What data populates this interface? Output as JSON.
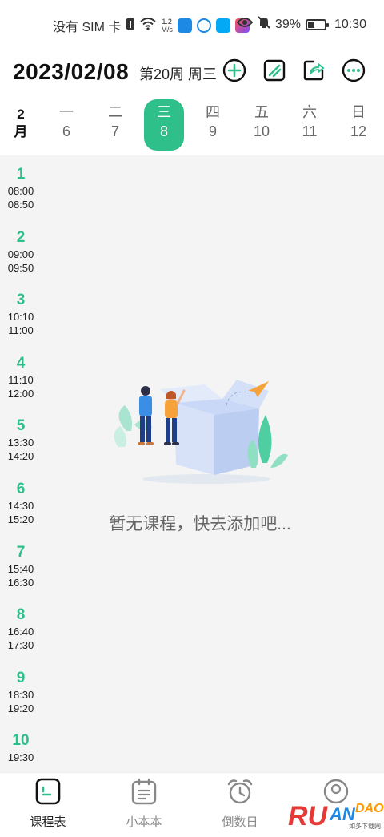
{
  "status_bar": {
    "carrier": "没有 SIM 卡",
    "net_speed_value": "1.2",
    "net_speed_unit": "M/s",
    "battery": "39%",
    "battery_level": 0.39,
    "time": "10:30"
  },
  "header": {
    "date": "2023/02/08",
    "week_info": "第20周 周三"
  },
  "week": {
    "month_num": "2",
    "month_unit": "月",
    "days": [
      {
        "weekday": "一",
        "date": "6"
      },
      {
        "weekday": "二",
        "date": "7"
      },
      {
        "weekday": "三",
        "date": "8"
      },
      {
        "weekday": "四",
        "date": "9"
      },
      {
        "weekday": "五",
        "date": "10"
      },
      {
        "weekday": "六",
        "date": "11"
      },
      {
        "weekday": "日",
        "date": "12"
      }
    ],
    "selected_index": 2
  },
  "periods": [
    {
      "num": "1",
      "start": "08:00",
      "end": "08:50"
    },
    {
      "num": "2",
      "start": "09:00",
      "end": "09:50"
    },
    {
      "num": "3",
      "start": "10:10",
      "end": "11:00"
    },
    {
      "num": "4",
      "start": "11:10",
      "end": "12:00"
    },
    {
      "num": "5",
      "start": "13:30",
      "end": "14:20"
    },
    {
      "num": "6",
      "start": "14:30",
      "end": "15:20"
    },
    {
      "num": "7",
      "start": "15:40",
      "end": "16:30"
    },
    {
      "num": "8",
      "start": "16:40",
      "end": "17:30"
    },
    {
      "num": "9",
      "start": "18:30",
      "end": "19:20"
    },
    {
      "num": "10",
      "start": "19:30",
      "end": ""
    }
  ],
  "empty_state": {
    "message": "暂无课程，快去添加吧..."
  },
  "tabs": [
    {
      "label": "课程表"
    },
    {
      "label": "小本本"
    },
    {
      "label": "倒数日"
    },
    {
      "label": ""
    }
  ],
  "watermark": {
    "brand": "RUANDAO",
    "sub": "如多下载网"
  },
  "colors": {
    "accent": "#2ebf8a",
    "grid_bg": "#f4f4f5"
  }
}
